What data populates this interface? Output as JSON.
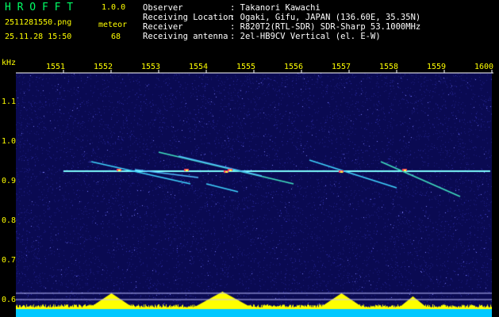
{
  "header": {
    "app_name": "H R O F F T",
    "version": "1.0.0",
    "filename": "2511281550.png",
    "mode": "meteor",
    "timestamp": "25.11.28 15:50",
    "count": "68",
    "info_labels": [
      "Observer",
      "Receiving Location",
      "Receiver",
      "Receiving antenna"
    ],
    "info_values": [
      ": Takanori Kawachi",
      ": Ogaki, Gifu, JAPAN (136.60E, 35.35N)",
      ": R820T2(RTL-SDR) SDR-Sharp 53.1000MHz",
      ": 2el-HB9CV Vertical (el. E-W)"
    ]
  },
  "time_axis": {
    "labels": [
      "1551",
      "1552",
      "1553",
      "1554",
      "1555",
      "1556",
      "1557",
      "1558",
      "1559",
      "1600"
    ]
  },
  "freq_axis": {
    "unit": "kHz",
    "labels": [
      "1.1",
      "1.0",
      "0.9",
      "0.8",
      "0.7",
      "0.6"
    ]
  },
  "colors": {
    "background": "#000000",
    "spectrogram_bg": "#0a0a52",
    "carrier": "#7fffff",
    "accent_yellow": "#ffff00",
    "logo_green": "#00ff66"
  }
}
